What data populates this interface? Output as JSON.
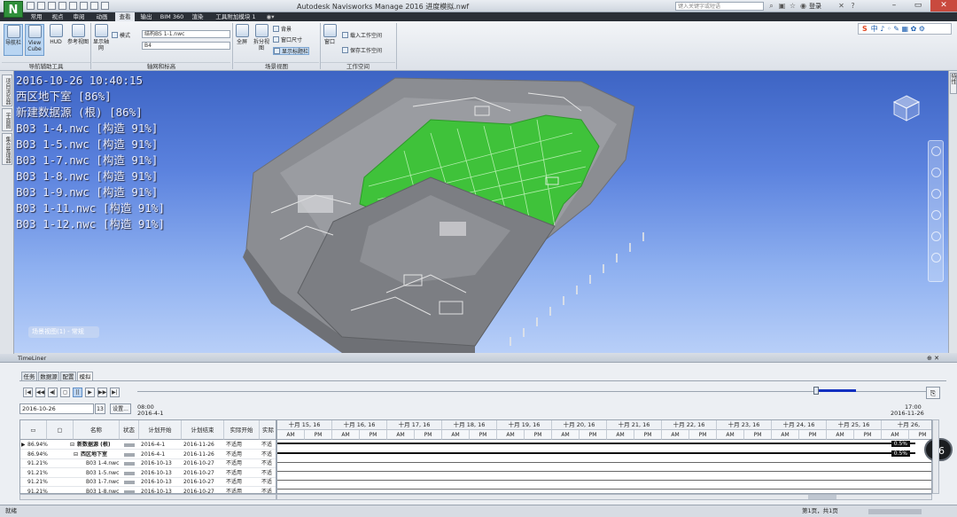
{
  "titlebar": {
    "app_logo": "N",
    "title": "Autodesk Navisworks Manage 2016    进度模拟.nwf",
    "search_placeholder": "键入关键字或短语",
    "user": "登录",
    "help": "?"
  },
  "tabs": [
    "常用",
    "视点",
    "审阅",
    "动画",
    "查看",
    "输出",
    "BIM 360",
    "渲染",
    "工具附加模块 1"
  ],
  "active_tab": 4,
  "ribbon": {
    "nav_tools": {
      "navbar": "导航栏",
      "viewcube": "View\nCube",
      "hud": "HUD",
      "ref_views": "参考视图",
      "group": "导航辅助工具"
    },
    "grid": {
      "show_grid": "显示轴网",
      "mode": "模式",
      "level_combo": "结构BS 1-1.nwc",
      "level2_combo": "B4",
      "group": "轴网和标高"
    },
    "scene": {
      "fullscreen": "全屏",
      "split_view": "拆分视图",
      "background": "背景",
      "window_size": "窗口尺寸",
      "show_title": "显示标题栏",
      "group": "场景视图"
    },
    "workspace": {
      "windows": "窗口",
      "load_ws": "载入工作空间",
      "save_ws": "保存工作空间",
      "group": "工作空间"
    },
    "lang_bar": "中 ♪ ◦ ✎ ▦ ✿ ⚙"
  },
  "left_panel_tabs": [
    "项目浏览器",
    "平面图",
    "集合管理器"
  ],
  "right_panel_tab": "特性",
  "viewport": {
    "overlay_lines": [
      "2016-10-26 10:40:15",
      "西区地下室 [86%]",
      "新建数据源 (根) [86%]",
      "B03 1-4.nwc [构造 91%]",
      "B03 1-5.nwc [构造 91%]",
      "B03 1-7.nwc [构造 91%]",
      "B03 1-8.nwc [构造 91%]",
      "B03 1-9.nwc [构造 91%]",
      "B03 1-11.nwc [构造 91%]",
      "B03 1-12.nwc [构造 91%]"
    ],
    "status_chip": "场景视图(1) - 常规",
    "colors": {
      "sky_top": "#3d64c4",
      "sky_bottom": "#b8cff8",
      "highlight": "#43c33c",
      "model": "#8a8c90"
    }
  },
  "timeliner": {
    "title": "TimeLiner",
    "tabs": [
      "任务",
      "数据源",
      "配置",
      "模拟"
    ],
    "active_tab": 3,
    "playback": [
      "|◀",
      "◀◀",
      "◀|",
      "◻",
      "||",
      "▶",
      "▶▶",
      "▶|"
    ],
    "active_playback": 4,
    "start_time": "08:00",
    "start_date": "2016-4-1",
    "end_time": "17:00",
    "end_date": "2016-11-26",
    "progress": 0.86,
    "current_date": "2016-10-26",
    "calendar_btn": "13",
    "settings_btn": "设置...",
    "columns": [
      "",
      "",
      "名称",
      "状态",
      "计划开始",
      "计划结束",
      "实际开始",
      "实际"
    ],
    "rows": [
      {
        "pct": "86.94%",
        "name": "新数据源 (根)",
        "start": "2016-4-1",
        "end": "2016-11-26",
        "actual": "不适用",
        "act2": "不适",
        "bold": true,
        "level": 0
      },
      {
        "pct": "86.94%",
        "name": "西区地下室",
        "start": "2016-4-1",
        "end": "2016-11-26",
        "actual": "不适用",
        "act2": "不适",
        "bold": true,
        "level": 1
      },
      {
        "pct": "91.21%",
        "name": "B03 1-4.nwc",
        "start": "2016-10-13",
        "end": "2016-10-27",
        "actual": "不适用",
        "act2": "不适",
        "bold": false,
        "level": 2
      },
      {
        "pct": "91.21%",
        "name": "B03 1-5.nwc",
        "start": "2016-10-13",
        "end": "2016-10-27",
        "actual": "不适用",
        "act2": "不适",
        "bold": false,
        "level": 2
      },
      {
        "pct": "91.21%",
        "name": "B03 1-7.nwc",
        "start": "2016-10-13",
        "end": "2016-10-27",
        "actual": "不适用",
        "act2": "不适",
        "bold": false,
        "level": 2
      },
      {
        "pct": "91.21%",
        "name": "B03 1-8.nwc",
        "start": "2016-10-13",
        "end": "2016-10-27",
        "actual": "不适用",
        "act2": "不适",
        "bold": false,
        "level": 2
      }
    ],
    "gantt_days": [
      "十月 15, 16",
      "十月 16, 16",
      "十月 17, 16",
      "十月 18, 16",
      "十月 19, 16",
      "十月 20, 16",
      "十月 21, 16",
      "十月 22, 16",
      "十月 23, 16",
      "十月 24, 16",
      "十月 25, 16",
      "十月 26,"
    ],
    "ampm": [
      "AM",
      "PM"
    ],
    "gantt_marker": "0.5%",
    "zoom_badge": "46"
  },
  "statusbar": {
    "left": "就绪",
    "pages": "第1页，共1页"
  }
}
